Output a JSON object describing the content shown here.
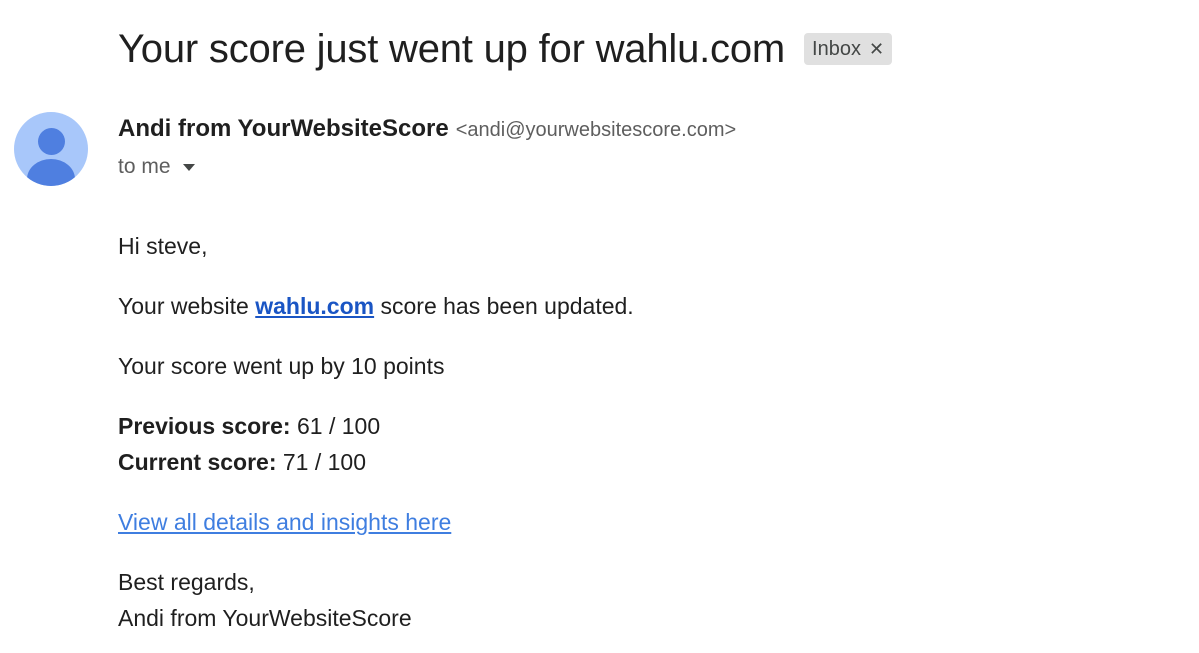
{
  "email": {
    "subject": "Your score just went up for wahlu.com",
    "label": "Inbox",
    "label_close_icon": "close-icon",
    "sender": {
      "name": "Andi from YourWebsiteScore",
      "email": "<andi@yourwebsitescore.com>",
      "avatar_icon": "person-avatar-icon",
      "avatar_bg": "#a8c7fa",
      "avatar_fg": "#4f7fe0"
    },
    "recipient": "to me",
    "recipient_details_icon": "caret-down-icon",
    "body": {
      "greeting": "Hi steve,",
      "update_prefix": "Your website ",
      "update_link": "wahlu.com",
      "update_suffix": " score has been updated.",
      "went_up": "Your score went up by 10 points",
      "previous_label": "Previous score:",
      "previous_value": " 61 / 100",
      "current_label": "Current score:",
      "current_value": " 71 / 100",
      "details_link": "View all details and insights here",
      "signoff": "Best regards,",
      "signature": "Andi from YourWebsiteScore"
    }
  },
  "colors": {
    "primary_link": "#1a55c4",
    "secondary_link": "#3f7ee0",
    "chip_bg": "#e0e0e0"
  }
}
